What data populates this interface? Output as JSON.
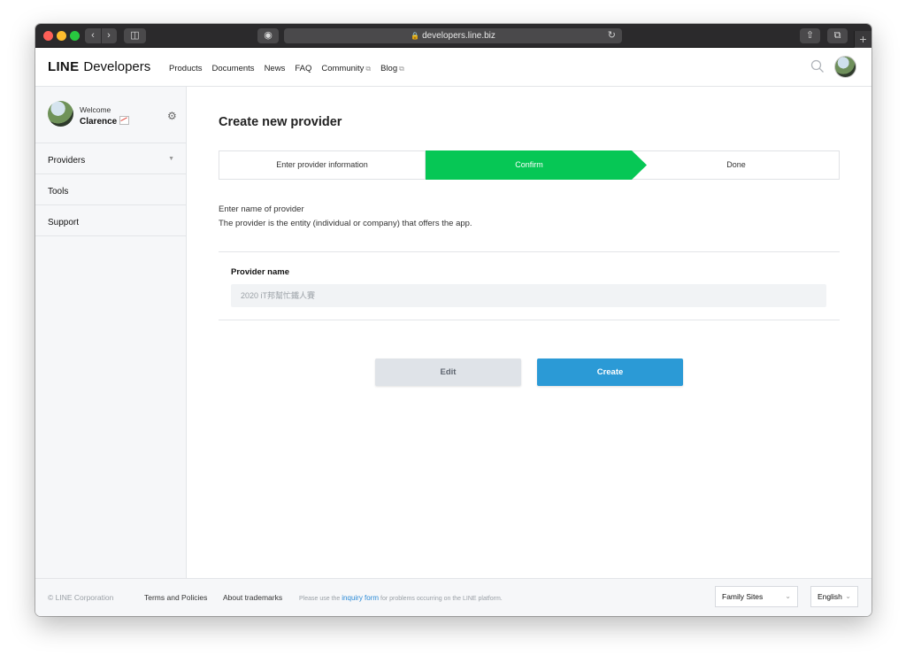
{
  "browser": {
    "url": "developers.line.biz",
    "new_tab_label": "+"
  },
  "header": {
    "logo_bold": "LINE",
    "logo_rest": "Developers",
    "nav": [
      {
        "label": "Products"
      },
      {
        "label": "Documents"
      },
      {
        "label": "News"
      },
      {
        "label": "FAQ"
      },
      {
        "label": "Community"
      },
      {
        "label": "Blog"
      }
    ]
  },
  "sidebar": {
    "welcome": "Welcome",
    "user_name": "Clarence",
    "items": [
      {
        "label": "Providers"
      },
      {
        "label": "Tools"
      },
      {
        "label": "Support"
      }
    ]
  },
  "main": {
    "title": "Create new provider",
    "steps": [
      {
        "label": "Enter provider information",
        "active": false
      },
      {
        "label": "Confirm",
        "active": true
      },
      {
        "label": "Done",
        "active": false
      }
    ],
    "description_line1": "Enter name of provider",
    "description_line2": "The provider is the entity (individual or company) that offers the app.",
    "field_label": "Provider name",
    "field_value": "2020 iT邦幫忙鐵人賽",
    "edit_label": "Edit",
    "create_label": "Create"
  },
  "footer": {
    "copyright": "© LINE Corporation",
    "terms": "Terms and Policies",
    "trademarks": "About trademarks",
    "note_before": "Please use the ",
    "note_link": "inquiry form",
    "note_after": " for problems occurring on the LINE platform.",
    "family_sites": "Family Sites",
    "language": "English"
  },
  "colors": {
    "active_step": "#06c755",
    "create_button": "#2b9ad6",
    "edit_button": "#dfe3e8"
  },
  "icons": {
    "search": "search-icon",
    "settings": "gear-icon",
    "external": "external-link-icon"
  }
}
